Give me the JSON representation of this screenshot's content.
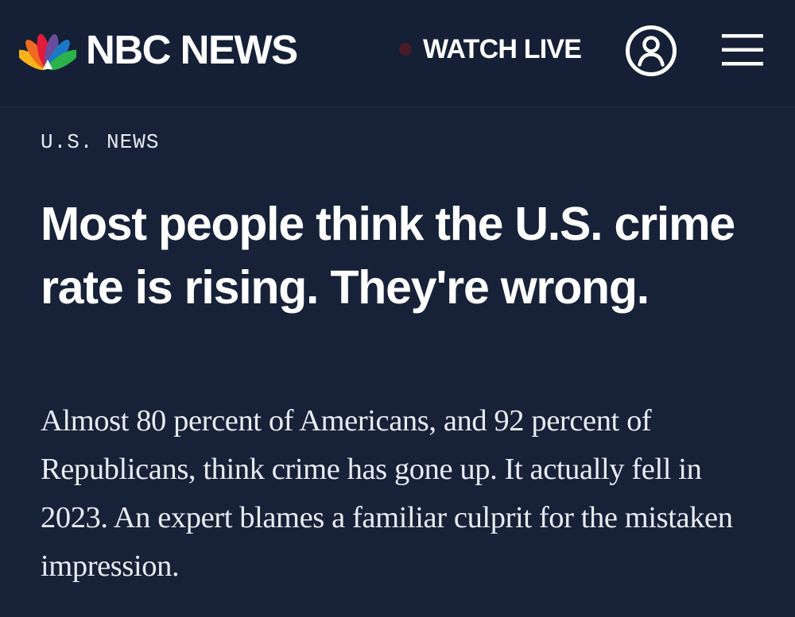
{
  "header": {
    "brand": "NBC NEWS",
    "watch_live": "WATCH LIVE",
    "peacock_colors": [
      "#f8b31b",
      "#f06b1f",
      "#e31b3b",
      "#6a4c9c",
      "#1b78c6",
      "#2ab24b"
    ],
    "account_icon": "account-icon",
    "menu_icon": "hamburger-menu-icon"
  },
  "article": {
    "section": "U.S. NEWS",
    "headline": "Most people think the U.S. crime rate is rising. They're wrong.",
    "dek": "Almost 80 percent of Americans, and 92 percent of Republicans, think crime has gone up. It actually fell in 2023. An expert blames a familiar culprit for the mistaken impression."
  },
  "colors": {
    "background": "#172238",
    "header_background": "#152036",
    "text": "#ffffff",
    "live_dot": "#4a1a2a"
  }
}
